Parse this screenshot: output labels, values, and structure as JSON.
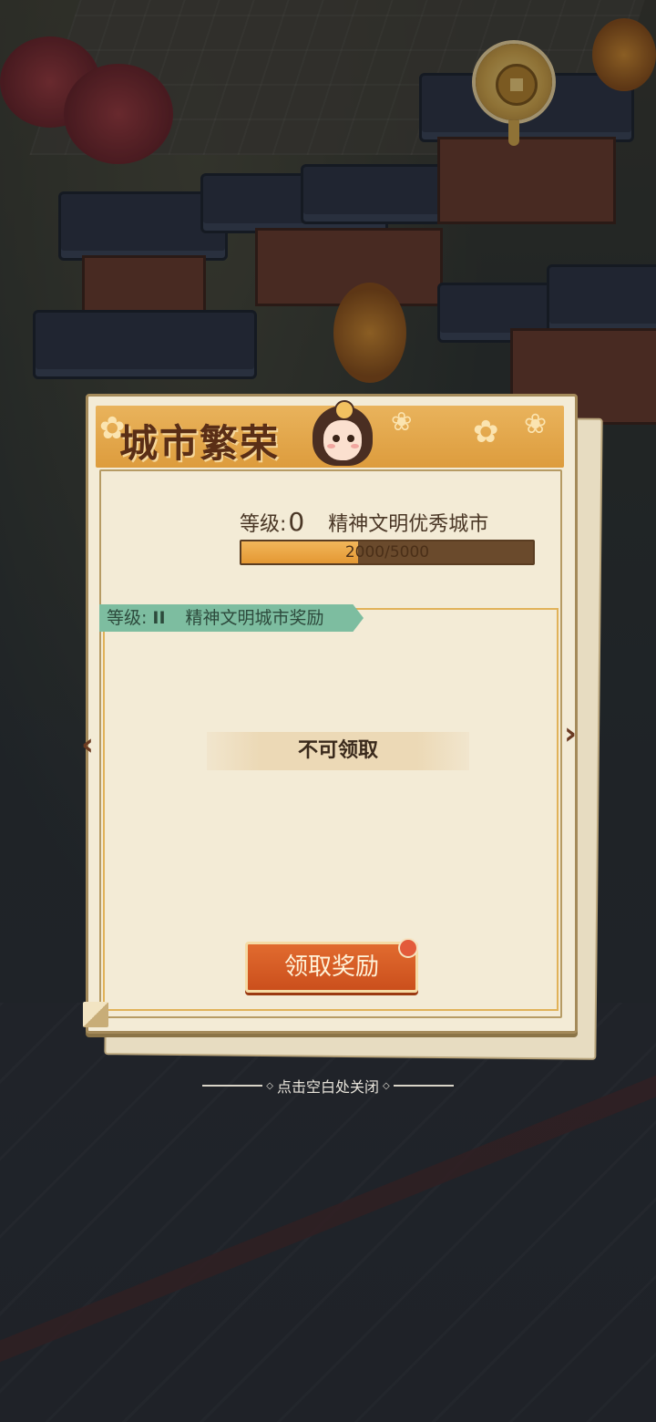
{
  "dialog": {
    "title": "城市繁荣",
    "level_label": "等级:",
    "level_value": "0",
    "city_title": "精神文明优秀城市",
    "progress": {
      "current": 2000,
      "max": 5000,
      "text": "2000/5000"
    },
    "reward_tier": {
      "level_label": "等级:",
      "level_value": "II",
      "name": "精神文明城市奖励"
    },
    "status_text": "不可领取",
    "claim_button": "领取奖励",
    "close_hint": "点击空白处关闭"
  },
  "colors": {
    "banner": "#dd9c3d",
    "panel": "#f3ebd6",
    "tag": "#7dbda0",
    "button": "#cb4f1c"
  }
}
